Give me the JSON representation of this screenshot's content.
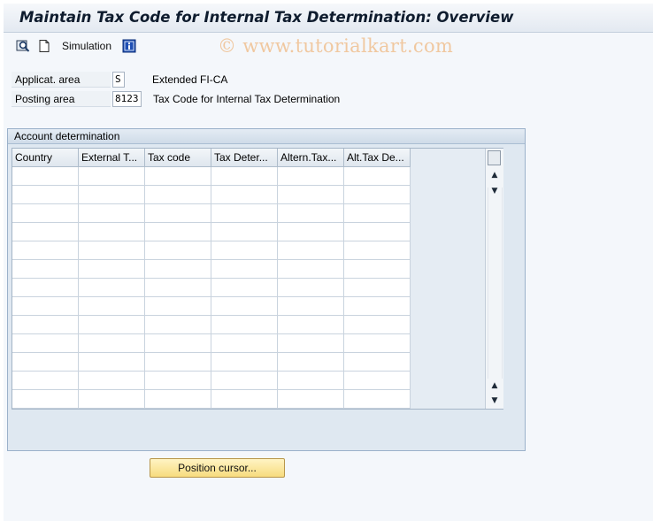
{
  "window": {
    "title": "Maintain Tax Code for Internal Tax Determination: Overview"
  },
  "toolbar": {
    "simulation_label": "Simulation",
    "icons": [
      "find-icon",
      "new-document-icon",
      "info-icon"
    ]
  },
  "watermark": "© www.tutorialkart.com",
  "fields": {
    "applicat_area": {
      "label": "Applicat. area",
      "value": "S",
      "description": "Extended FI-CA"
    },
    "posting_area": {
      "label": "Posting area",
      "value": "8123",
      "description": "Tax Code for Internal Tax Determination"
    }
  },
  "account_determination": {
    "title": "Account determination",
    "columns": [
      "Country",
      "External T...",
      "Tax code",
      "Tax Deter...",
      "Altern.Tax...",
      "Alt.Tax De..."
    ],
    "row_count": 13
  },
  "actions": {
    "position_cursor_label": "Position cursor..."
  },
  "colors": {
    "title_text": "#0f1c2e",
    "button_fill": "#f7dc7e",
    "groupbox_fill": "#dfe8f1"
  }
}
